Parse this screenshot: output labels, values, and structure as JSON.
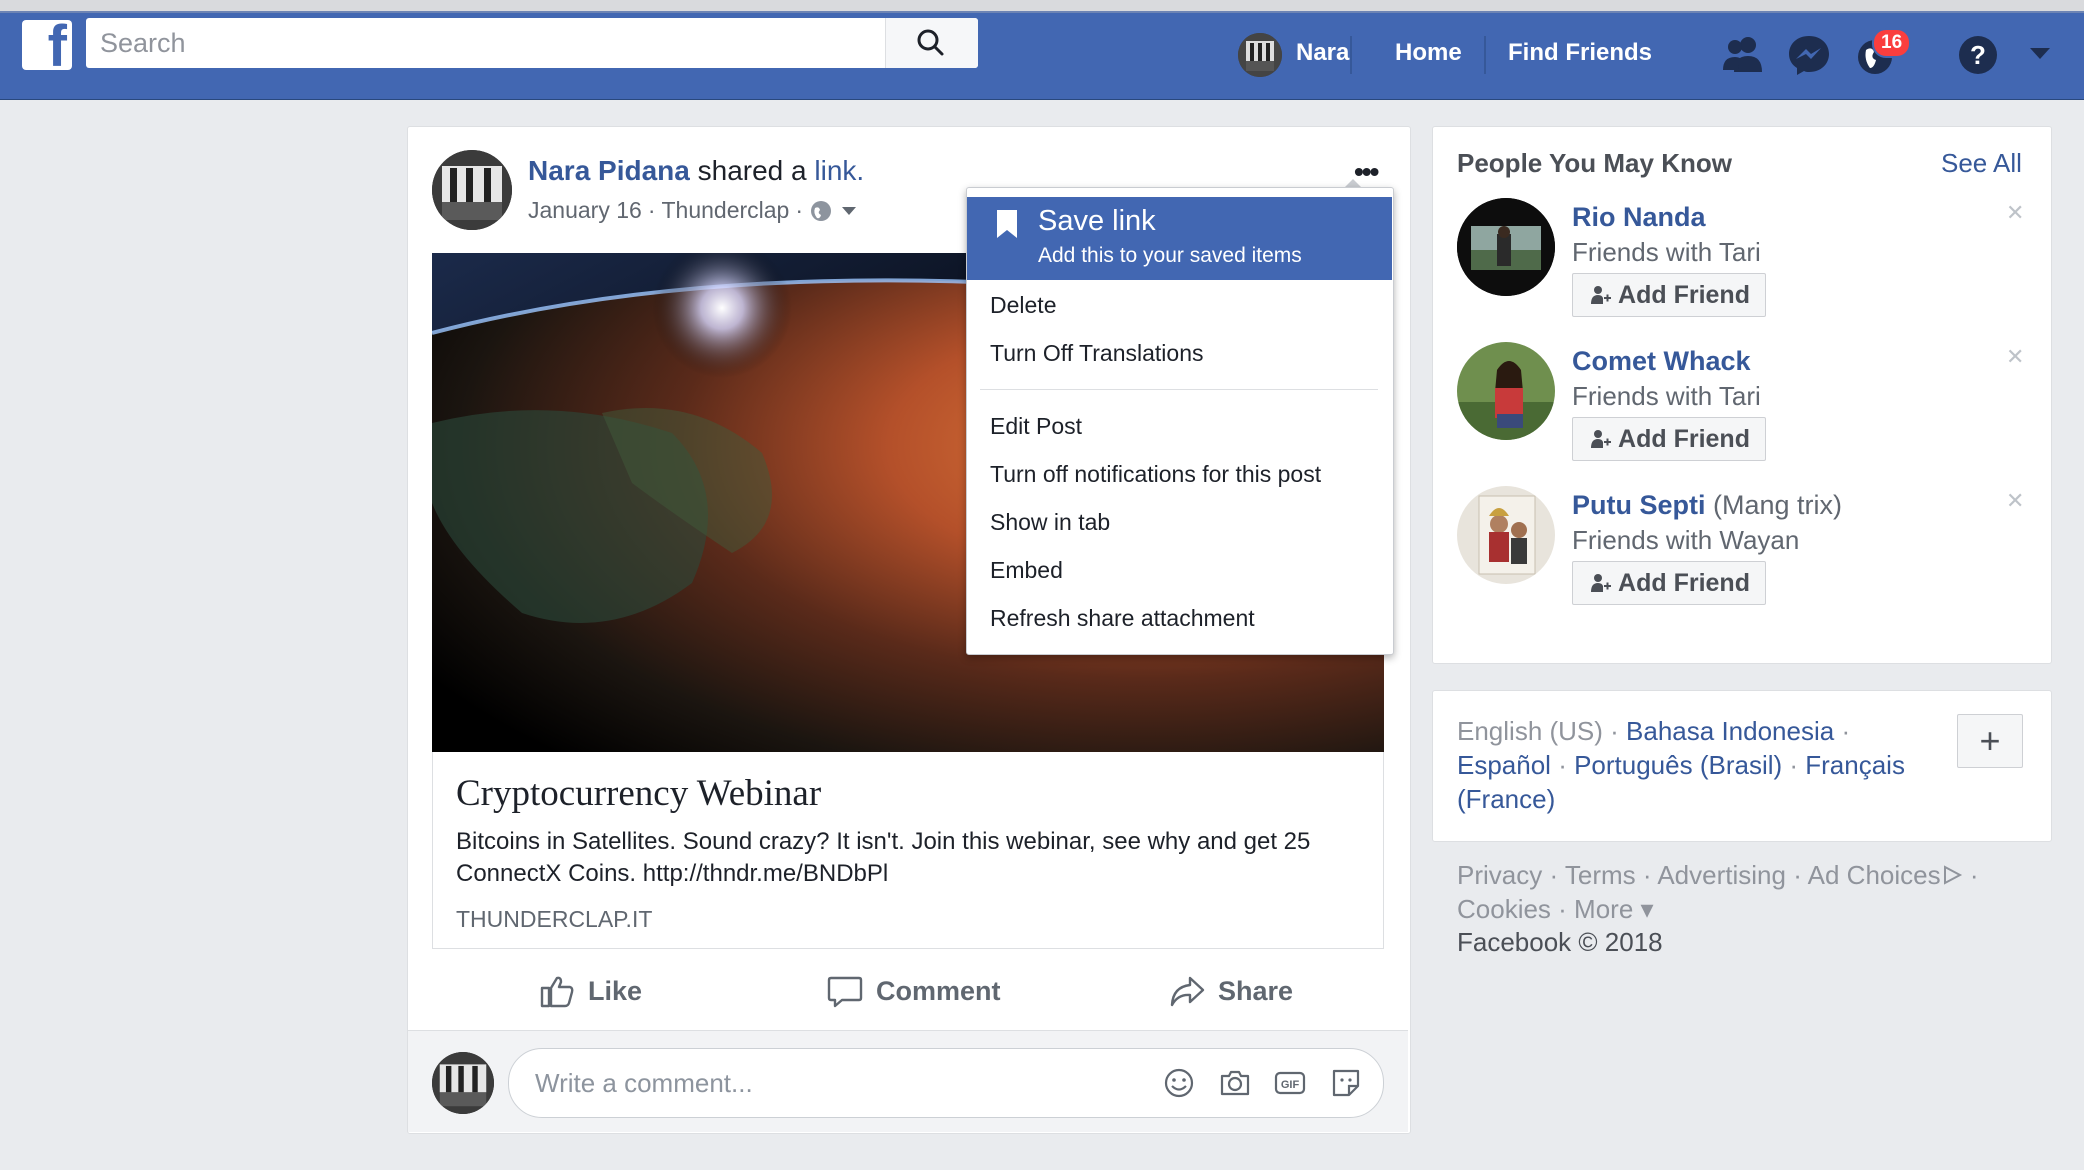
{
  "header": {
    "search_placeholder": "Search",
    "user_name": "Nara",
    "nav_home": "Home",
    "nav_find_friends": "Find Friends",
    "notification_count": "16",
    "icons": [
      "facebook-logo-icon",
      "search-icon",
      "friend-requests-icon",
      "messenger-icon",
      "notifications-globe-icon",
      "help-icon",
      "caret-down-icon"
    ]
  },
  "post": {
    "author": "Nara Pidana",
    "action_text": "shared a",
    "action_link": "link.",
    "date": "January 16",
    "separator": "·",
    "app": "Thunderclap",
    "more_label": "•••",
    "link": {
      "title": "Cryptocurrency Webinar",
      "description": "Bitcoins in Satellites. Sound crazy? It isn't. Join this webinar, see why and get 25 ConnectX Coins. http://thndr.me/BNDbPl",
      "domain": "THUNDERCLAP.IT"
    },
    "actions": {
      "like": "Like",
      "comment": "Comment",
      "share": "Share"
    },
    "comment_placeholder": "Write a comment..."
  },
  "menu": {
    "save_title": "Save link",
    "save_subtitle": "Add this to your saved items",
    "items_group1": [
      "Delete",
      "Turn Off Translations"
    ],
    "items_group2": [
      "Edit Post",
      "Turn off notifications for this post",
      "Show in tab",
      "Embed",
      "Refresh share attachment"
    ]
  },
  "pymk": {
    "title": "People You May Know",
    "see_all": "See All",
    "add_friend_label": "Add Friend",
    "people": [
      {
        "name": "Rio Nanda",
        "alias": "",
        "mutual": "Friends with Tari"
      },
      {
        "name": "Comet Whack",
        "alias": "",
        "mutual": "Friends with Tari"
      },
      {
        "name": "Putu Septi",
        "alias": "(Mang trix)",
        "mutual": "Friends with Wayan"
      }
    ]
  },
  "languages": {
    "current": "English (US)",
    "options": [
      "Bahasa Indonesia",
      "Español",
      "Português (Brasil)",
      "Français (France)"
    ],
    "plus": "+"
  },
  "footer": {
    "links": [
      "Privacy",
      "Terms",
      "Advertising",
      "Ad Choices",
      "Cookies",
      "More"
    ],
    "copyright": "Facebook © 2018"
  },
  "colors": {
    "brand": "#4267b2",
    "link": "#365899",
    "badge": "#fa3e3e",
    "background": "#e9ebee"
  }
}
